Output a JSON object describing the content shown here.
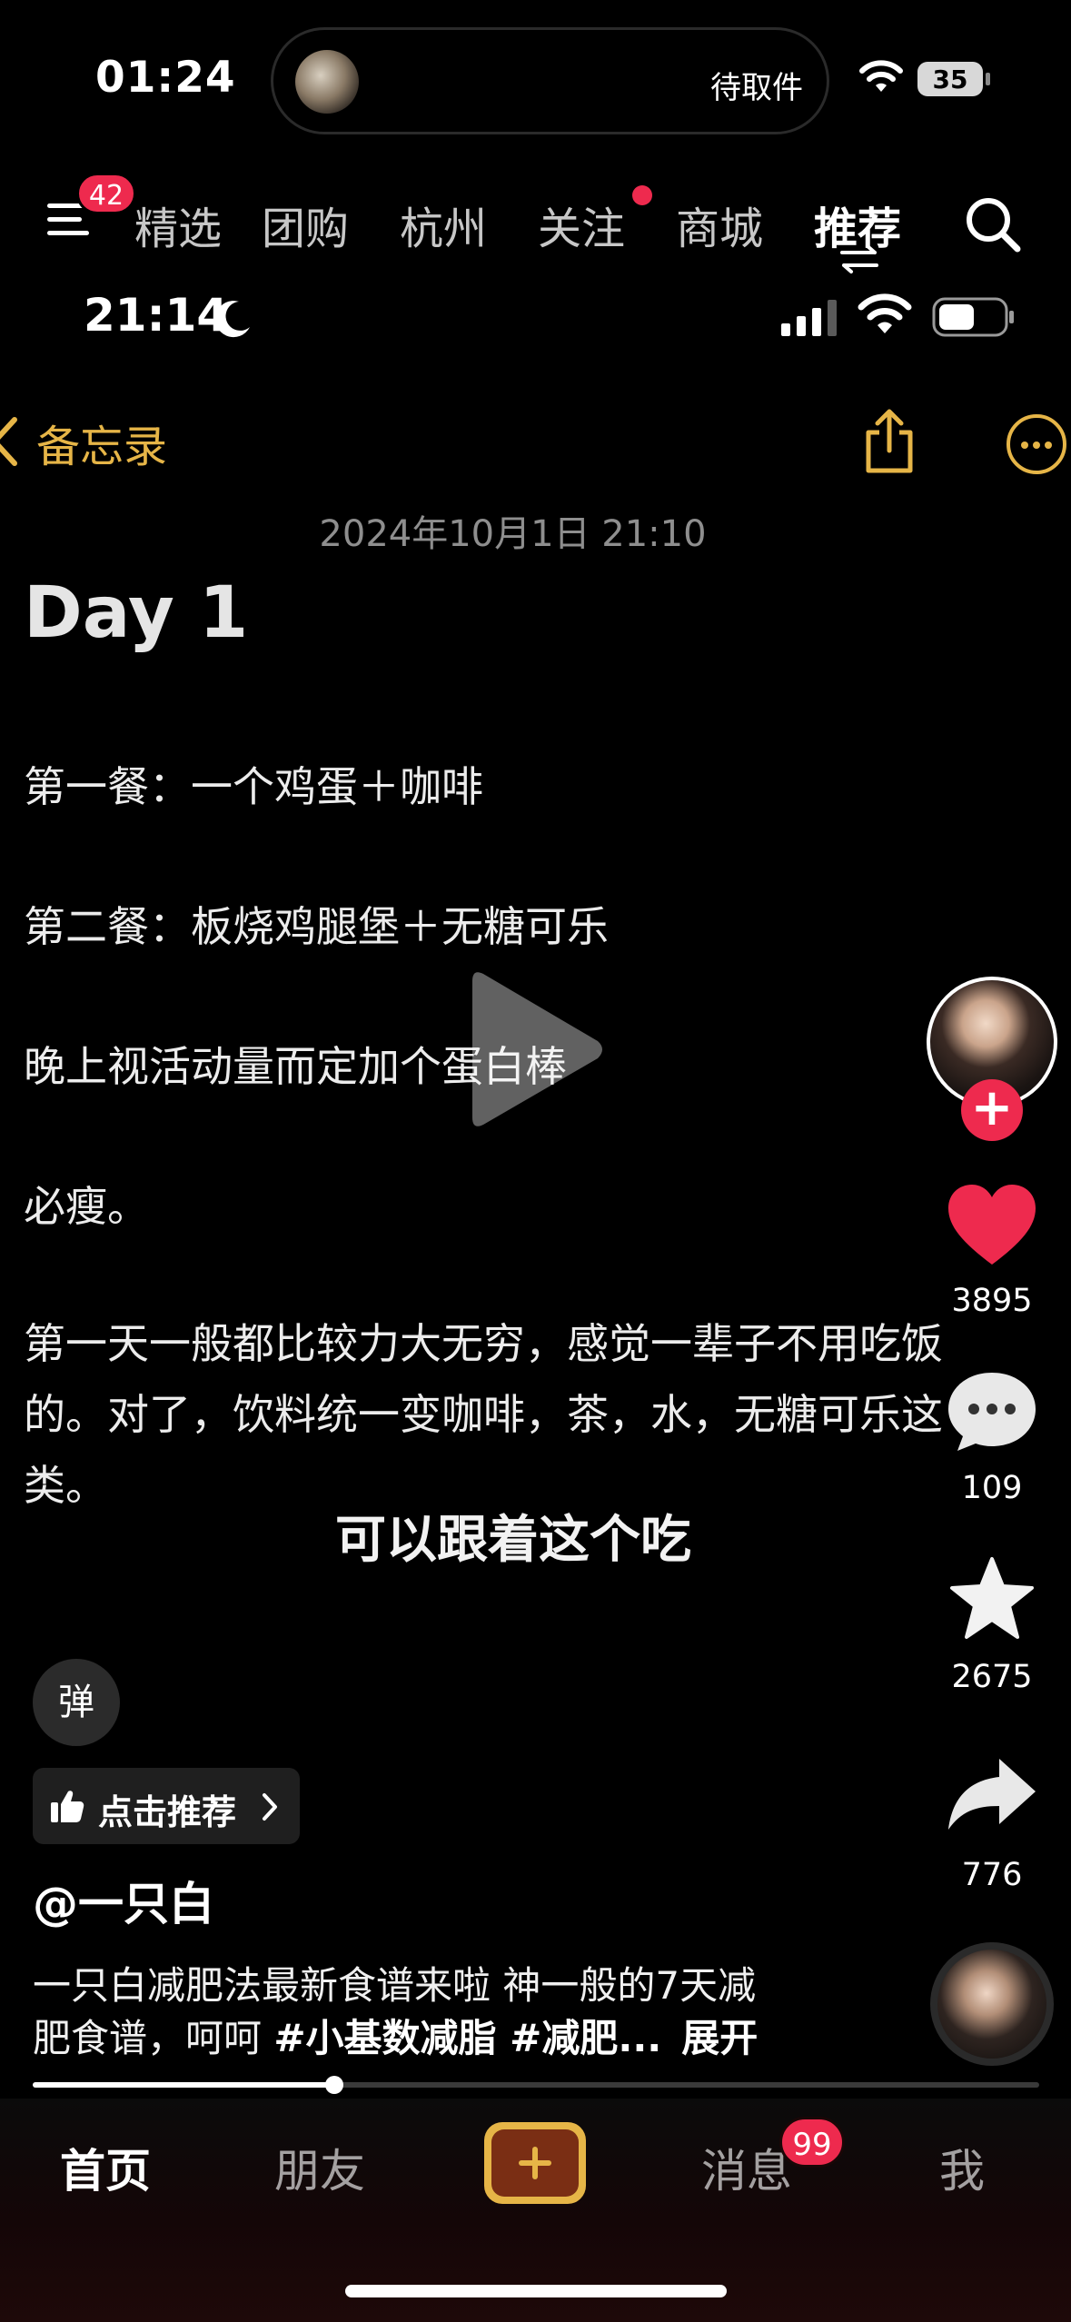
{
  "status_bar": {
    "time": "01:24",
    "island_text": "待取件",
    "battery": "35"
  },
  "top_nav": {
    "menu_badge": "42",
    "tabs": [
      {
        "label": "精选"
      },
      {
        "label": "团购"
      },
      {
        "label": "杭州"
      },
      {
        "label": "关注"
      },
      {
        "label": "商城"
      },
      {
        "label": "推荐"
      }
    ]
  },
  "video": {
    "inner_time": "21:14",
    "notes_back_label": "备忘录",
    "note_date": "2024年10月1日 21:10",
    "note_title": "Day 1",
    "lines": [
      "第一餐：一个鸡蛋＋咖啡",
      "第二餐：板烧鸡腿堡＋无糖可乐",
      "晚上视活动量而定加个蛋白棒",
      "必瘦。"
    ],
    "paragraph": "第一天一般都比较力大无穷，感觉一辈子不用吃饭的。对了，饮料统一变咖啡，茶，水，无糖可乐这类。",
    "caption_overlay": "可以跟着这个吃"
  },
  "rail": {
    "likes": "3895",
    "comments": "109",
    "favorites": "2675",
    "shares": "776"
  },
  "info": {
    "danmu_label": "弹",
    "recommend_label": "点击推荐",
    "author": "@一只白",
    "desc_line1": "一只白减肥法最新食谱来啦 神一般的7天减",
    "desc_line2_prefix": "肥食谱，呵呵 ",
    "desc_line2_tags": "#小基数减脂 #减肥...",
    "expand_label": "展开"
  },
  "progress": {
    "fraction": 0.3
  },
  "bottom_tabs": {
    "home": "首页",
    "friends": "朋友",
    "messages": "消息",
    "messages_badge": "99",
    "me": "我"
  },
  "colors": {
    "accent_gold": "#e6b547",
    "badge_red": "#ee2a4e",
    "like_red": "#ee2a4e"
  }
}
